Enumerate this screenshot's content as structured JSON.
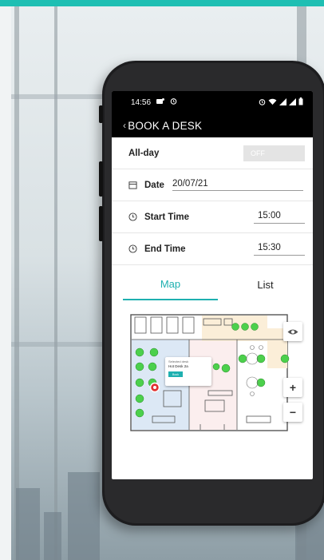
{
  "status_bar": {
    "time": "14:56",
    "left_icons": [
      "message-badge-icon",
      "alarm-icon"
    ],
    "right_icons": [
      "alarm-icon",
      "wifi-icon",
      "signal-icon",
      "battery-icon"
    ]
  },
  "app_bar": {
    "back_icon": "‹",
    "title": "BOOK A DESK"
  },
  "form": {
    "all_day": {
      "label": "All-day",
      "toggle_text": "OFF"
    },
    "date": {
      "label": "Date",
      "value": "20/07/21"
    },
    "start_time": {
      "label": "Start Time",
      "value": "15:00"
    },
    "end_time": {
      "label": "End Time",
      "value": "15:30"
    }
  },
  "tabs": [
    {
      "label": "Map",
      "active": true
    },
    {
      "label": "List",
      "active": false
    }
  ],
  "map": {
    "popup": {
      "line1": "Selected desk",
      "line2": "Hot Desk 2a",
      "button": "Book"
    },
    "controls": {
      "visibility_icon": "eye-icon",
      "zoom_in": "+",
      "zoom_out": "−"
    }
  },
  "colors": {
    "accent": "#1fb0b0",
    "desk_available": "#4cd04c",
    "desk_selected": "#e03030",
    "status_bar": "#000000"
  }
}
